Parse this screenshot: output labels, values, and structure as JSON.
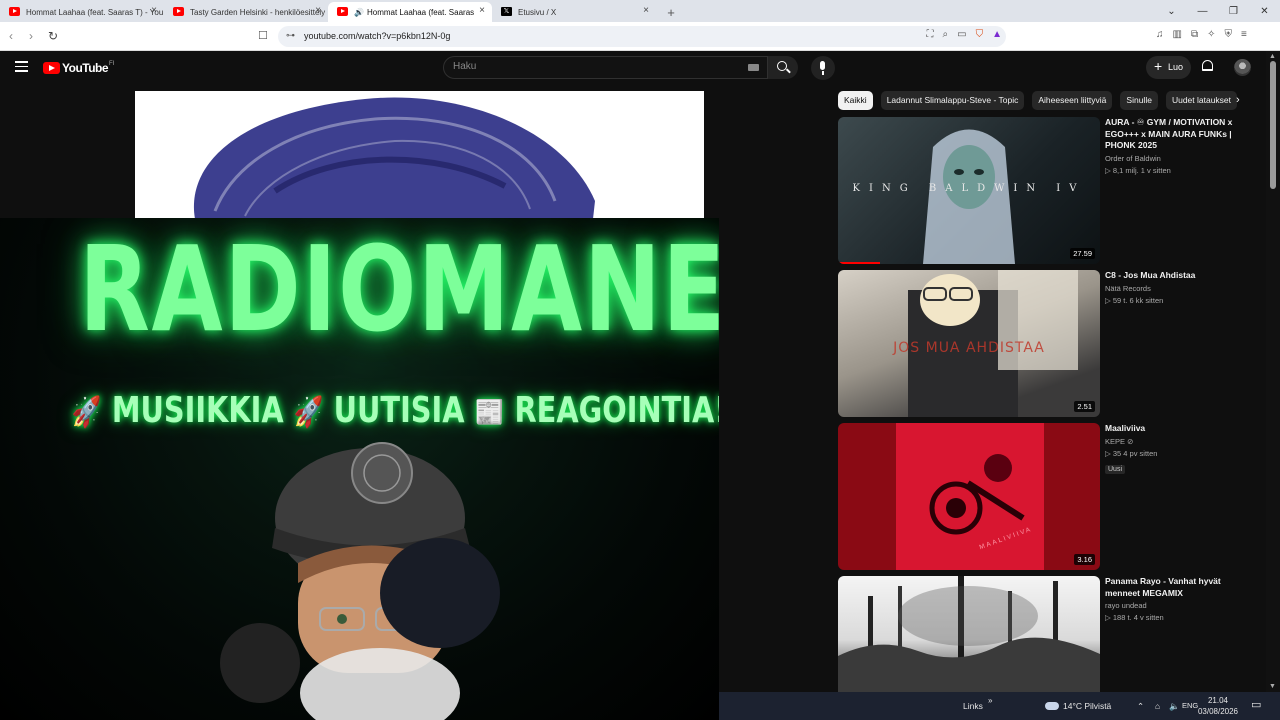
{
  "browser": {
    "tabs": [
      {
        "label": "Hommat Laahaa (feat. Saaras T) - You",
        "icon": "youtube-icon",
        "active": false
      },
      {
        "label": "Tasty Garden Helsinki - henkilöesittely",
        "icon": "youtube-icon",
        "active": false
      },
      {
        "label": "Hommat Laahaa (feat. Saaras",
        "icon": "youtube-icon",
        "active": true
      },
      {
        "label": "Etusivu / X",
        "icon": "x-icon",
        "active": false
      }
    ],
    "url": "youtube.com/watch?v=p6kbn12N-0g"
  },
  "header": {
    "logo_text": "YouTube",
    "country_code": "FI",
    "search_placeholder": "Haku",
    "create_label": "Luo"
  },
  "overlay": {
    "title": "RADIOMANE",
    "sub_items": [
      "MUSIIKKIA",
      "UUTISIA",
      "REAGOINTIA!"
    ]
  },
  "chips": [
    "Kaikki",
    "Ladannut Slimalappu-Steve - Topic",
    "Aiheeseen liittyviä",
    "Sinulle",
    "Uudet lataukset"
  ],
  "recommendations": [
    {
      "title": "AURA - ♾ GYM / MOTIVATION x EGO+++ x MAIN AURA FUNKs | PHONK 2025",
      "channel": "Order of Baldwin",
      "stats": "▷ 8,1 milj.  1 v sitten",
      "duration": "27.59",
      "thumb_text": "KING BALDWIN IV",
      "badge": ""
    },
    {
      "title": "C8 - Jos Mua Ahdistaa",
      "channel": "Nätä Records",
      "stats": "▷ 59 t.  6 kk sitten",
      "duration": "2.51",
      "thumb_text": "JOS MUA AHDISTAA",
      "badge": ""
    },
    {
      "title": "Maaliviiva",
      "channel": "KEPE ⊘",
      "stats": "▷ 35  4 pv sitten",
      "duration": "3.16",
      "thumb_text": "MAALIVIIVA",
      "badge": "Uusi"
    },
    {
      "title": "Panama Rayo - Vanhat hyvät menneet MEGAMIX",
      "channel": "rayo undead",
      "stats": "▷ 188 t.  4 v sitten",
      "duration": "",
      "thumb_text": "",
      "badge": ""
    }
  ],
  "taskbar": {
    "links": "Links",
    "weather": "14°C  Pilvistä",
    "lang": "ENG",
    "time": "21.04",
    "date": "03/08/2026"
  },
  "colors": {
    "accent": "#ff0000",
    "neon_green": "#7dff9a",
    "background": "#0f0f0f"
  }
}
